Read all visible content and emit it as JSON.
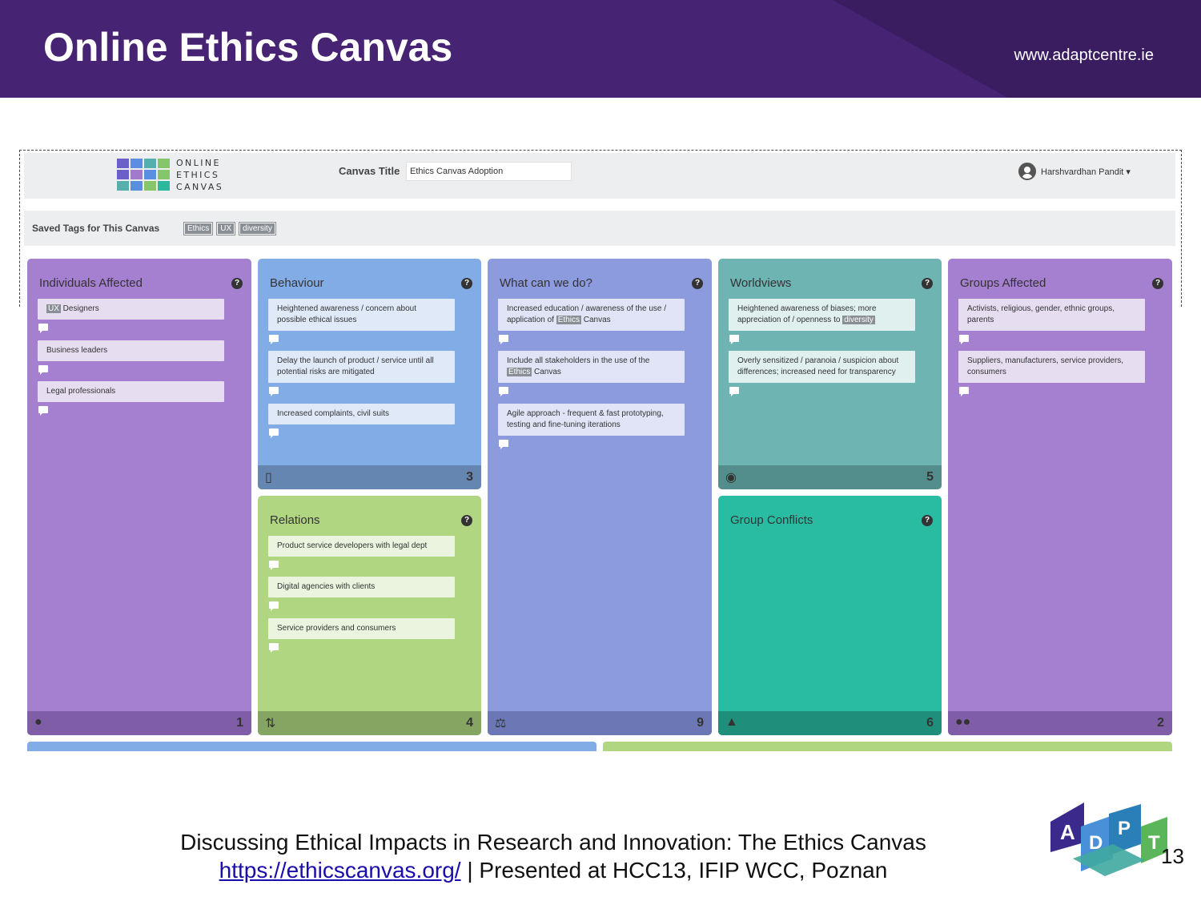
{
  "slide": {
    "title": "Online Ethics Canvas",
    "site": "www.adaptcentre.ie",
    "caption_line1": "Discussing Ethical Impacts in Research and Innovation: The Ethics Canvas",
    "caption_link": "https://ethicscanvas.org/",
    "caption_line2_rest": " | Presented at HCC13, IFIP WCC, Poznan",
    "page_number": "13"
  },
  "app": {
    "logo_lines": [
      "ONLINE",
      "ETHICS",
      "CANVAS"
    ],
    "canvas_title_label": "Canvas Title",
    "canvas_title_value": "Ethics Canvas Adoption",
    "user_name": "Harshvardhan Pandit ▾",
    "saved_tags_label": "Saved Tags for This Canvas",
    "tags": [
      "Ethics",
      "UX",
      "diversity"
    ]
  },
  "colors": {
    "purple": "#a57fd0",
    "blue": "#82ace6",
    "periwinkle": "#8c9ade",
    "teal": "#6db4b3",
    "green": "#b0d682",
    "sea": "#2abca3"
  },
  "cards": {
    "individuals": {
      "title": "Individuals Affected",
      "number": "1",
      "icon": "user-icon",
      "items": [
        {
          "pre": "",
          "tag": "UX",
          "post": " Designers"
        },
        {
          "pre": "Business leaders",
          "tag": "",
          "post": ""
        },
        {
          "pre": "Legal professionals",
          "tag": "",
          "post": ""
        }
      ]
    },
    "behaviour": {
      "title": "Behaviour",
      "number": "3",
      "icon": "mobile-icon",
      "items": [
        {
          "pre": "Heightened awareness / concern about possible ethical issues",
          "tag": "",
          "post": ""
        },
        {
          "pre": "Delay the launch of product / service until all potential risks are mitigated",
          "tag": "",
          "post": ""
        },
        {
          "pre": "Increased complaints, civil suits",
          "tag": "",
          "post": ""
        }
      ]
    },
    "whatcan": {
      "title": "What can we do?",
      "number": "9",
      "icon": "scales-icon",
      "items": [
        {
          "pre": "Increased education / awareness of the use / application of ",
          "tag": "Ethics",
          "post": " Canvas"
        },
        {
          "pre": "Include all stakeholders in the use of the ",
          "tag": "Ethics",
          "post": " Canvas"
        },
        {
          "pre": "Agile approach - frequent & fast prototyping, testing and fine-tuning iterations",
          "tag": "",
          "post": ""
        }
      ]
    },
    "worldviews": {
      "title": "Worldviews",
      "number": "5",
      "icon": "globe-icon",
      "items": [
        {
          "pre": "Heightened awareness of biases; more appreciation of / openness to ",
          "tag": "diversity",
          "post": ""
        },
        {
          "pre": "Overly sensitized / paranoia / suspicion about differences; increased need for transparency",
          "tag": "",
          "post": ""
        }
      ]
    },
    "groups": {
      "title": "Groups Affected",
      "number": "2",
      "icon": "users-icon",
      "items": [
        {
          "pre": "Activists, religious, gender, ethnic groups, parents",
          "tag": "",
          "post": ""
        },
        {
          "pre": "Suppliers, manufacturers, service providers, consumers",
          "tag": "",
          "post": ""
        }
      ]
    },
    "relations": {
      "title": "Relations",
      "number": "4",
      "icon": "relations-icon",
      "items": [
        {
          "pre": "Product service developers with legal dept",
          "tag": "",
          "post": ""
        },
        {
          "pre": "Digital agencies with clients",
          "tag": "",
          "post": ""
        },
        {
          "pre": "Service providers and consumers",
          "tag": "",
          "post": ""
        }
      ]
    },
    "conflicts": {
      "title": "Group Conflicts",
      "number": "6",
      "icon": "fire-icon",
      "items": []
    }
  }
}
